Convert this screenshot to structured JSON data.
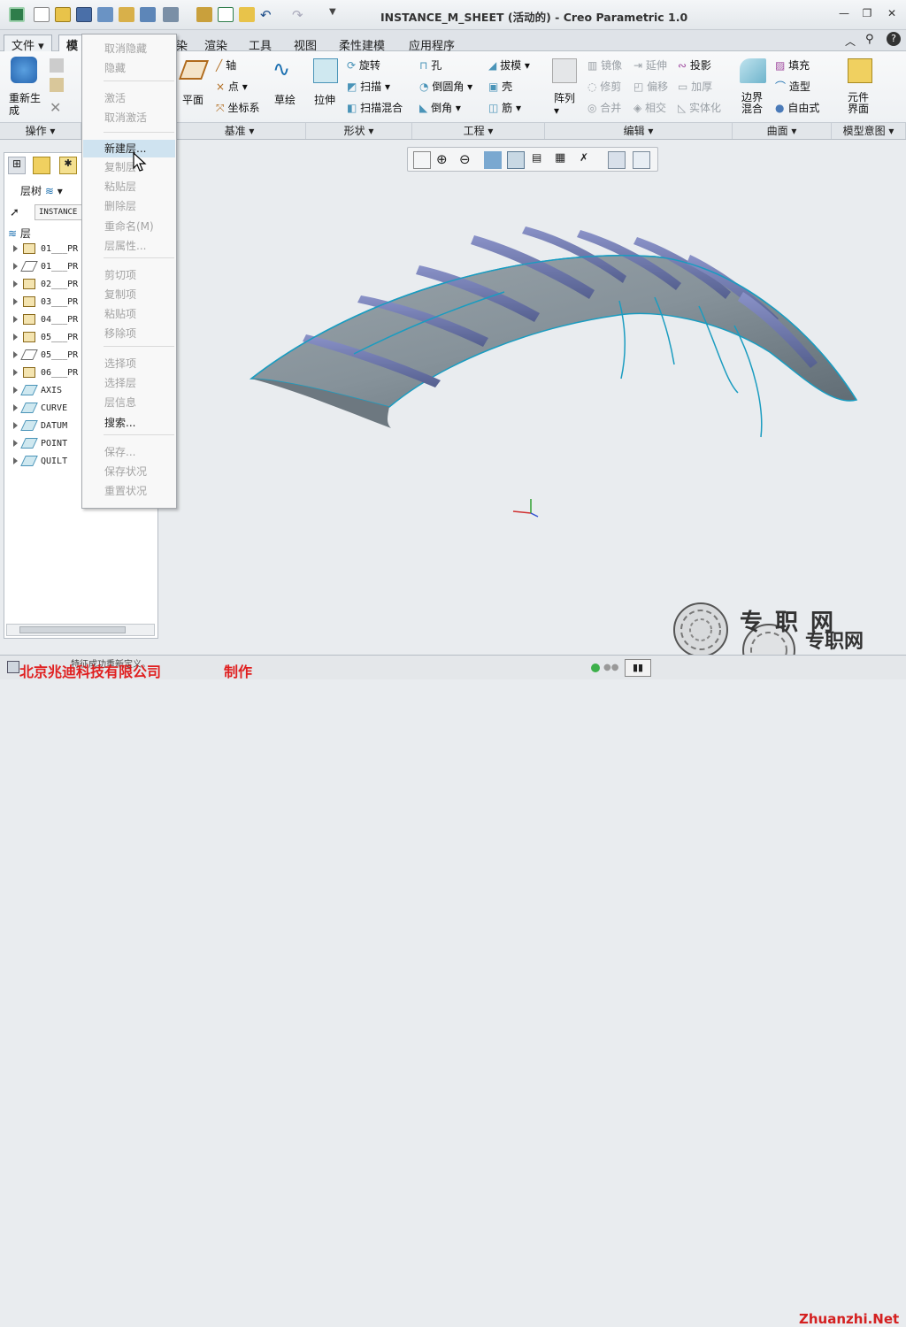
{
  "window": {
    "title": "INSTANCE_M_SHEET (活动的) - Creo Parametric 1.0",
    "minimize": "—",
    "restore": "❐",
    "close": "✕"
  },
  "tabs": [
    "文件",
    "模",
    "染",
    "渲染",
    "工具",
    "视图",
    "柔性建模",
    "应用程序"
  ],
  "ribbon": {
    "operations": {
      "regen": "重新生成",
      "group": "操作"
    },
    "datum": {
      "plane": "平面",
      "axis": "轴",
      "point": "点",
      "csys": "坐标系",
      "sketch": "草绘",
      "group": "基准"
    },
    "shapes": {
      "extrude": "拉伸",
      "revolve": "旋转",
      "sweep": "扫描",
      "blend": "扫描混合",
      "group": "形状"
    },
    "engineering": {
      "hole": "孔",
      "round": "倒圆角",
      "chamfer": "倒角",
      "draft": "拔模",
      "shell": "壳",
      "rib": "筋",
      "group": "工程"
    },
    "editing": {
      "pattern": "阵列",
      "mirror": "镜像",
      "trim": "修剪",
      "merge": "合并",
      "extend": "延伸",
      "offset": "偏移",
      "intersect": "相交",
      "project": "投影",
      "thicken": "加厚",
      "solidify": "实体化",
      "group": "编辑"
    },
    "surfaces": {
      "boundary": "边界混合",
      "fill": "填充",
      "style": "造型",
      "freestyle": "自由式",
      "group": "曲面"
    },
    "model_intent": {
      "component_interface": "元件界面",
      "group": "模型意图"
    }
  },
  "left_panel": {
    "tree_label": "层树",
    "model_field": "INSTANCE",
    "root": "层",
    "items": [
      "01___PR",
      "01___PR",
      "02___PR",
      "03___PR",
      "04___PR",
      "05___PR",
      "05___PR",
      "06___PR",
      "AXIS",
      "CURVE",
      "DATUM",
      "POINT",
      "QUILT"
    ]
  },
  "context_menu": {
    "items": [
      {
        "label": "取消隐藏",
        "enabled": false
      },
      {
        "label": "隐藏",
        "enabled": false
      },
      {
        "label": "激活",
        "enabled": false
      },
      {
        "label": "取消激活",
        "enabled": false
      },
      {
        "label": "新建层...",
        "enabled": true,
        "highlight": true
      },
      {
        "label": "复制层",
        "enabled": false
      },
      {
        "label": "粘贴层",
        "enabled": false
      },
      {
        "label": "删除层",
        "enabled": false
      },
      {
        "label": "重命名(M)",
        "enabled": false
      },
      {
        "label": "层属性...",
        "enabled": false
      },
      {
        "label": "剪切项",
        "enabled": false
      },
      {
        "label": "复制项",
        "enabled": false
      },
      {
        "label": "粘贴项",
        "enabled": false
      },
      {
        "label": "移除项",
        "enabled": false
      },
      {
        "label": "选择项",
        "enabled": false
      },
      {
        "label": "选择层",
        "enabled": false
      },
      {
        "label": "层信息",
        "enabled": false
      },
      {
        "label": "搜索...",
        "enabled": true
      },
      {
        "label": "保存...",
        "enabled": false
      },
      {
        "label": "保存状况",
        "enabled": false
      },
      {
        "label": "重置状况",
        "enabled": false
      }
    ]
  },
  "status": {
    "message": "特征成功重新定义。",
    "company": "北京兆迪科技有限公司",
    "made": "制作"
  },
  "watermark": {
    "cn1": "专职网",
    "cn2": "专职网",
    "en": "Zhuanzhi.Net"
  },
  "colors": {
    "accent": "#2f8fb0",
    "surface": "#8a959c",
    "rib": "#6f78b0",
    "edge": "#1a9cc0",
    "watermark_red": "#d42020"
  }
}
